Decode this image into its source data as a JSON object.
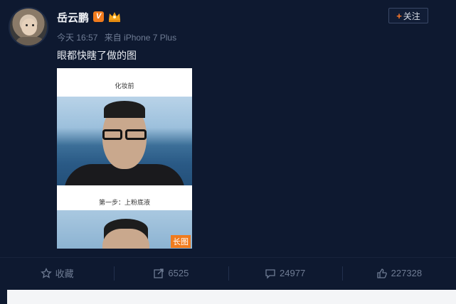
{
  "post": {
    "username": "岳云鹏",
    "badge_v": "V",
    "follow_label": "关注",
    "follow_plus": "+",
    "meta": {
      "time": "今天 16:57",
      "source": "来自 iPhone 7 Plus"
    },
    "text": "眼都快瞎了做的图",
    "image": {
      "heading_top": "化妆前",
      "heading_mid": "第一步：上粉底液",
      "long_tag": "长图"
    }
  },
  "actions": {
    "favorite_label": "收藏",
    "repost_count": "6525",
    "comment_count": "24977",
    "like_count": "227328"
  },
  "colors": {
    "background": "#0e1930",
    "accent": "#f07b1d",
    "muted": "#6f7c94"
  },
  "icons": [
    "avatar",
    "verified-v-icon",
    "crown-icon",
    "star-icon",
    "repost-icon",
    "comment-icon",
    "thumbs-up-icon"
  ]
}
